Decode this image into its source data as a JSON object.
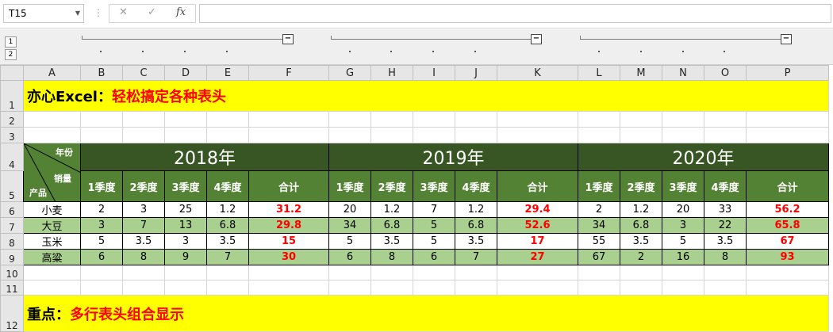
{
  "formula_bar": {
    "name_box": "T15",
    "cancel_icon": "✕",
    "enter_icon": "✓",
    "fx_label": "fx",
    "formula": ""
  },
  "outline": {
    "levels": [
      "1",
      "2"
    ],
    "collapse_symbol": "−"
  },
  "columns": [
    "A",
    "B",
    "C",
    "D",
    "E",
    "F",
    "G",
    "H",
    "I",
    "J",
    "K",
    "L",
    "M",
    "N",
    "O",
    "P"
  ],
  "rows": [
    "1",
    "2",
    "3",
    "4",
    "5",
    "6",
    "7",
    "8",
    "9",
    "10",
    "11",
    "12"
  ],
  "title": {
    "prefix": "亦心Excel：",
    "highlight": "轻松搞定各种表头"
  },
  "header": {
    "diag_top": "年份",
    "diag_mid": "销量",
    "diag_bottom": "产品",
    "years": [
      "2018年",
      "2019年",
      "2020年"
    ],
    "quarters": [
      "1季度",
      "2季度",
      "3季度",
      "4季度"
    ],
    "total": "合计"
  },
  "data": [
    {
      "product": "小麦",
      "y2018": [
        "2",
        "3",
        "25",
        "1.2",
        "31.2"
      ],
      "y2019": [
        "20",
        "1.2",
        "7",
        "1.2",
        "29.4"
      ],
      "y2020": [
        "2",
        "1.2",
        "20",
        "33",
        "56.2"
      ]
    },
    {
      "product": "大豆",
      "y2018": [
        "3",
        "7",
        "13",
        "6.8",
        "29.8"
      ],
      "y2019": [
        "34",
        "6.8",
        "5",
        "6.8",
        "52.6"
      ],
      "y2020": [
        "34",
        "6.8",
        "3",
        "22",
        "65.8"
      ]
    },
    {
      "product": "玉米",
      "y2018": [
        "5",
        "3.5",
        "3",
        "3.5",
        "15"
      ],
      "y2019": [
        "5",
        "3.5",
        "5",
        "3.5",
        "17"
      ],
      "y2020": [
        "55",
        "3.5",
        "5",
        "3.5",
        "67"
      ]
    },
    {
      "product": "高粱",
      "y2018": [
        "6",
        "8",
        "9",
        "7",
        "30"
      ],
      "y2019": [
        "6",
        "8",
        "6",
        "7",
        "27"
      ],
      "y2020": [
        "67",
        "2",
        "16",
        "8",
        "93"
      ]
    }
  ],
  "bottom_title": {
    "prefix": "重点：",
    "highlight": "多行表头组合显示"
  },
  "colors": {
    "year_header": "#375623",
    "quarter_header": "#548235",
    "band": "#a9d08e",
    "title_bg": "#ffff00",
    "total_text": "#ff0000"
  }
}
